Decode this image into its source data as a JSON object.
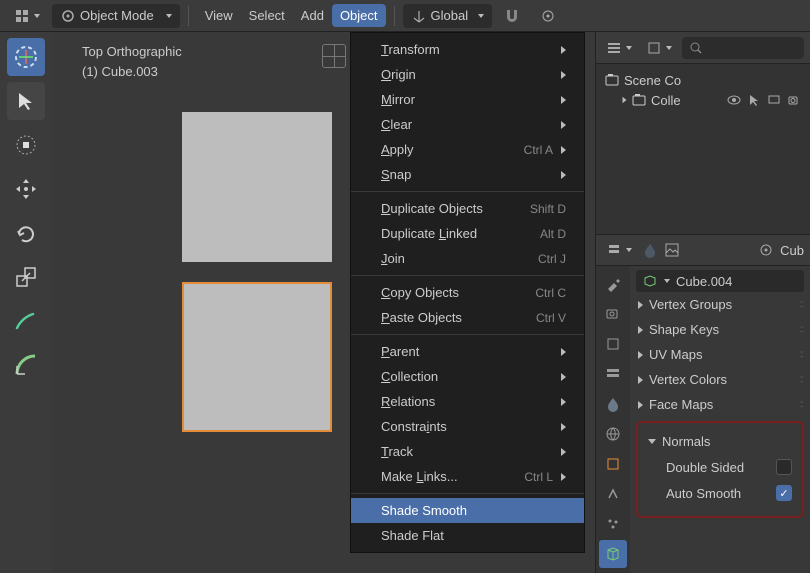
{
  "header": {
    "mode": "Object Mode",
    "menus": [
      "View",
      "Select",
      "Add",
      "Object"
    ],
    "active_menu": "Object",
    "orientation": "Global"
  },
  "viewport": {
    "title": "Top Orthographic",
    "subtitle": "(1) Cube.003"
  },
  "object_menu": {
    "groups": [
      [
        {
          "label": "Transform",
          "u": 0,
          "sub": true
        },
        {
          "label": "Origin",
          "u": 0,
          "sub": true
        },
        {
          "label": "Mirror",
          "u": 0,
          "sub": true
        },
        {
          "label": "Clear",
          "u": 0,
          "sub": true
        },
        {
          "label": "Apply",
          "u": 0,
          "sub": true,
          "sc": "Ctrl A"
        },
        {
          "label": "Snap",
          "u": 0,
          "sub": true
        }
      ],
      [
        {
          "label": "Duplicate Objects",
          "u": 0,
          "sc": "Shift D"
        },
        {
          "label": "Duplicate Linked",
          "u": 10,
          "sc": "Alt D"
        },
        {
          "label": "Join",
          "u": 0,
          "sc": "Ctrl J"
        }
      ],
      [
        {
          "label": "Copy Objects",
          "u": 0,
          "sc": "Ctrl C"
        },
        {
          "label": "Paste Objects",
          "u": 0,
          "sc": "Ctrl V"
        }
      ],
      [
        {
          "label": "Parent",
          "u": 0,
          "sub": true
        },
        {
          "label": "Collection",
          "u": 0,
          "sub": true
        },
        {
          "label": "Relations",
          "u": 0,
          "sub": true
        },
        {
          "label": "Constraints",
          "u": 7,
          "sub": true
        },
        {
          "label": "Track",
          "u": 0,
          "sub": true
        },
        {
          "label": "Make Links...",
          "u": 5,
          "sub": true,
          "sc": "Ctrl L"
        }
      ],
      [
        {
          "label": "Shade Smooth",
          "highlight": true
        },
        {
          "label": "Shade Flat"
        }
      ]
    ]
  },
  "outliner": {
    "scene": "Scene Co",
    "collection": "Colle"
  },
  "props": {
    "object": "Cub",
    "mesh": "Cube.004",
    "sections": [
      "Vertex Groups",
      "Shape Keys",
      "UV Maps",
      "Vertex Colors",
      "Face Maps"
    ],
    "normals": {
      "title": "Normals",
      "double_sided": "Double Sided",
      "auto_smooth": "Auto Smooth",
      "double_sided_checked": false,
      "auto_smooth_checked": true
    }
  }
}
